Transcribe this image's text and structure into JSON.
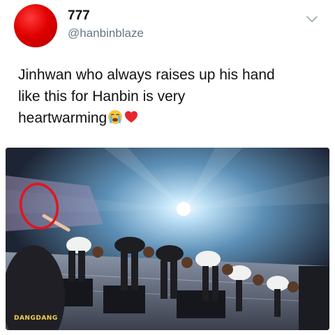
{
  "author": {
    "display_name": "777",
    "handle": "@hanbinblaze",
    "avatar_color": "#e00000"
  },
  "menu": {
    "icon": "chevron-down-icon"
  },
  "tweet": {
    "lines": [
      "Jinhwan who always raises up his hand",
      "like this for Hanbin is very",
      "heartwarming"
    ],
    "emojis": [
      "loudly-crying-face-icon",
      "red-heart-icon"
    ]
  },
  "media": {
    "watermark": "DANGDANG",
    "annotation": "red-circle",
    "annotation_color": "#e3141d"
  }
}
